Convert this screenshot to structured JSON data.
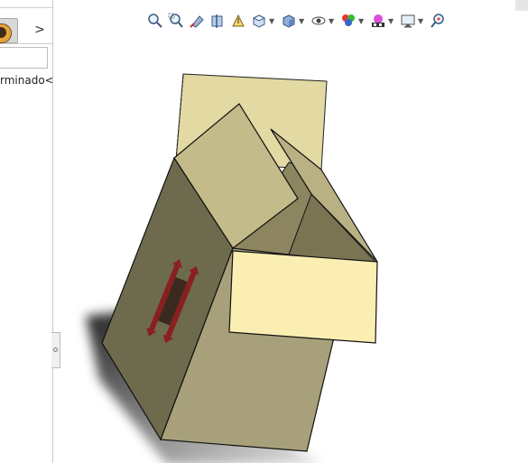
{
  "feature_tree": {
    "collapse_label": ">",
    "item_label": "rminado<"
  },
  "heads_up_toolbar": [
    "zoom-to-fit-icon",
    "zoom-to-area-icon",
    "previous-view-icon",
    "section-view-icon",
    "dynamic-annotation-icon",
    "view-orientation-icon",
    "display-style-icon",
    "hide-show-items-icon",
    "edit-appearance-icon",
    "apply-scene-icon",
    "view-settings-icon",
    "rotate-view-icon"
  ],
  "colors": {
    "box_side_dark": "#6e6a4d",
    "box_side_light": "#a7a07a",
    "box_flap": "#c4bb8a",
    "box_flap_back": "#e2d9a3",
    "box_inner_face": "#fbeeb2",
    "arrow_red": "#8a1f1f"
  }
}
